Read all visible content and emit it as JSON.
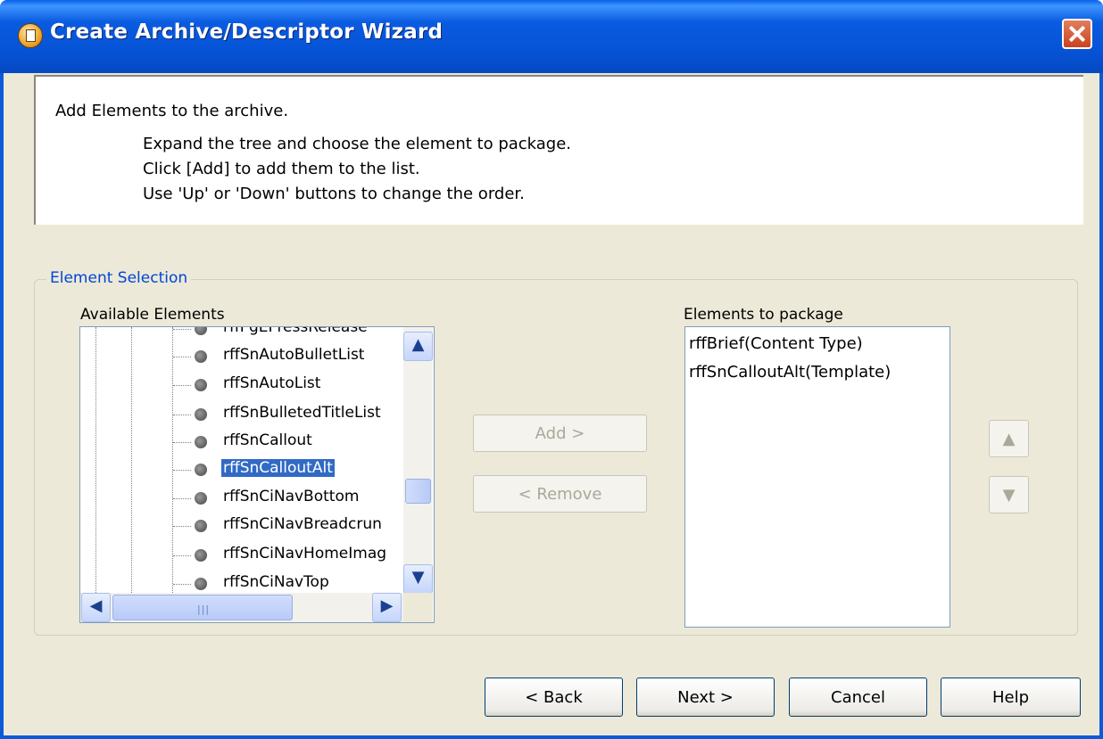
{
  "window": {
    "title": "Create Archive/Descriptor Wizard"
  },
  "instructions": {
    "heading": "Add Elements to the archive.",
    "line1": "Expand the tree and choose the element to package.",
    "line2": "Click [Add] to add them to the list.",
    "line3": "Use 'Up' or 'Down' buttons to change the order."
  },
  "element_selection": {
    "legend": "Element Selection",
    "available_label": "Available Elements",
    "package_label": "Elements to package",
    "tree_items": [
      {
        "label": "rffPgEPressRelease",
        "selected": false
      },
      {
        "label": "rffSnAutoBulletList",
        "selected": false
      },
      {
        "label": "rffSnAutoList",
        "selected": false
      },
      {
        "label": "rffSnBulletedTitleList",
        "selected": false
      },
      {
        "label": "rffSnCallout",
        "selected": false
      },
      {
        "label": "rffSnCalloutAlt",
        "selected": true
      },
      {
        "label": "rffSnCiNavBottom",
        "selected": false
      },
      {
        "label": "rffSnCiNavBreadcrun",
        "selected": false
      },
      {
        "label": "rffSnCiNavHomeImag",
        "selected": false
      },
      {
        "label": "rffSnCiNavTop",
        "selected": false
      }
    ],
    "package_items": [
      "rffBrief(Content Type)",
      "rffSnCalloutAlt(Template)"
    ],
    "add_label": "Add >",
    "remove_label": "< Remove"
  },
  "footer": {
    "back_label": "< Back",
    "next_label": "Next >",
    "cancel_label": "Cancel",
    "help_label": "Help"
  },
  "colors": {
    "title_bar": "#0653D6",
    "dialog_bg": "#ECE9D8",
    "selection": "#316AC5",
    "legend_text": "#0046D5"
  }
}
